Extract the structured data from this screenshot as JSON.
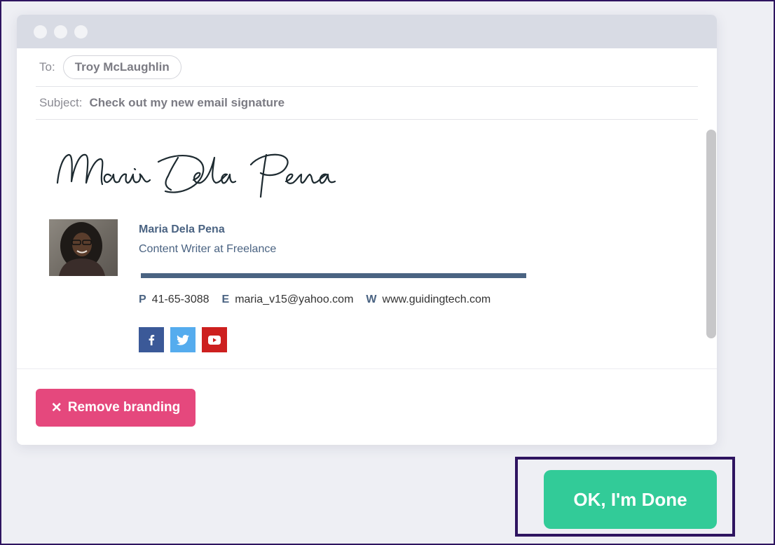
{
  "email": {
    "to_label": "To:",
    "to_recipient": "Troy McLaughlin",
    "subject_label": "Subject:",
    "subject": "Check out my new email signature"
  },
  "signature": {
    "script_name": "Maria Dela Pena",
    "name": "Maria Dela Pena",
    "title": "Content Writer at Freelance",
    "accent_color": "#4a6382",
    "contacts": [
      {
        "key": "P",
        "value": "41-65-3088"
      },
      {
        "key": "E",
        "value": "maria_v15@yahoo.com"
      },
      {
        "key": "W",
        "value": "www.guidingtech.com"
      }
    ],
    "social": [
      {
        "icon": "facebook-icon",
        "color": "#3b5998"
      },
      {
        "icon": "twitter-icon",
        "color": "#55acee"
      },
      {
        "icon": "youtube-icon",
        "color": "#cd201f"
      }
    ]
  },
  "actions": {
    "remove_icon": "✕",
    "remove_branding": "Remove branding",
    "remove_color": "#e5487d",
    "done": "OK, I'm Done",
    "done_color": "#32cb98"
  }
}
